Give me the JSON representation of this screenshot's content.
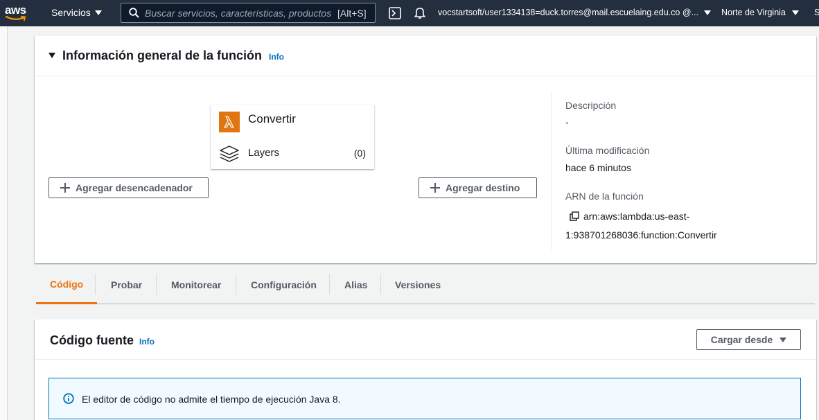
{
  "topnav": {
    "logo_text": "aws",
    "services_label": "Servicios",
    "search_placeholder": "Buscar servicios, características, productos de",
    "search_shortcut": "[Alt+S]",
    "account": "vocstartsoft/user1334138=duck.torres@mail.escuelaing.edu.co @...",
    "region": "Norte de Virginia",
    "support": "S"
  },
  "overview": {
    "title": "Información general de la función",
    "info": "Info",
    "function_name": "Convertir",
    "layers_label": "Layers",
    "layers_count": "(0)",
    "add_trigger": "Agregar desencadenador",
    "add_destination": "Agregar destino",
    "description_label": "Descripción",
    "description_value": "-",
    "last_modified_label": "Última modificación",
    "last_modified_value": "hace 6 minutos",
    "arn_label": "ARN de la función",
    "arn_line1": "arn:aws:lambda:us-east-",
    "arn_line2": "1:938701268036:function:Convertir"
  },
  "tabs": [
    {
      "label": "Código",
      "active": true
    },
    {
      "label": "Probar",
      "active": false
    },
    {
      "label": "Monitorear",
      "active": false
    },
    {
      "label": "Configuración",
      "active": false
    },
    {
      "label": "Alias",
      "active": false
    },
    {
      "label": "Versiones",
      "active": false
    }
  ],
  "code_source": {
    "title": "Código fuente",
    "info": "Info",
    "upload_from": "Cargar desde",
    "alert_text": "El editor de código no admite el tiempo de ejecución Java 8."
  },
  "colors": {
    "nav_bg": "#232f3e",
    "accent": "#ec7211",
    "link": "#0073bb",
    "lambda_orange": "#e07512"
  },
  "icons": [
    "aws-smile-icon",
    "search-icon",
    "cloudshell-icon",
    "bell-icon",
    "lambda-icon",
    "layers-icon",
    "plus-icon",
    "copy-icon",
    "info-circle-icon",
    "caret-down-icon"
  ]
}
